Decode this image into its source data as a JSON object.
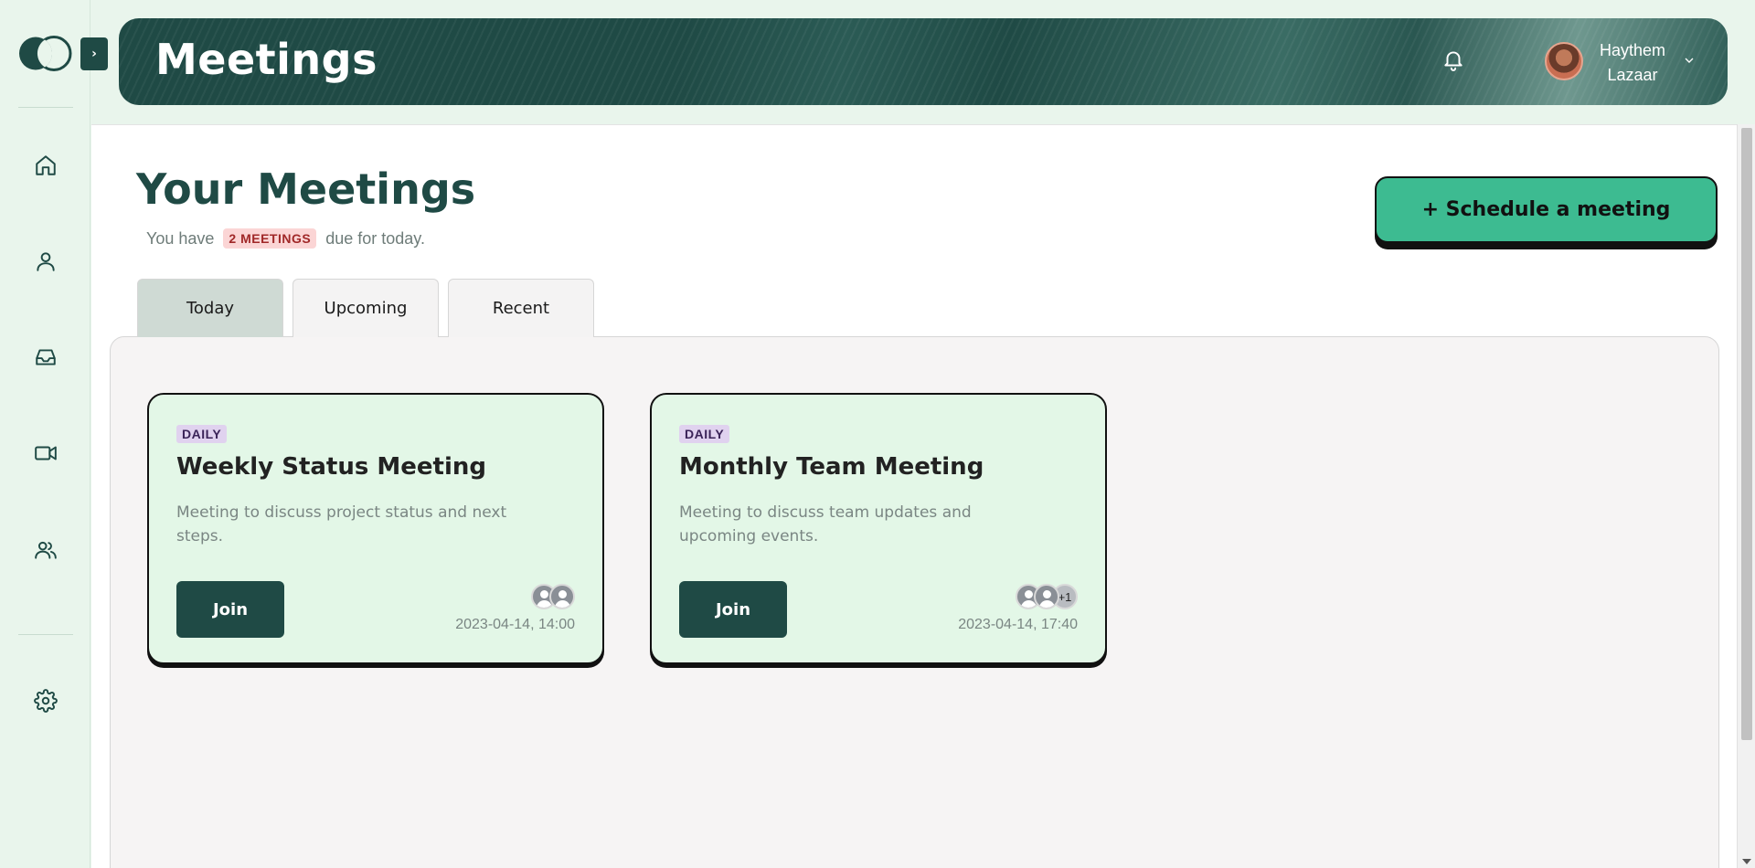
{
  "header": {
    "title": "Meetings",
    "user_first": "Haythem",
    "user_last": "Lazaar"
  },
  "sidebar": {
    "expand_label": "›",
    "items": [
      {
        "icon": "home-icon"
      },
      {
        "icon": "user-icon"
      },
      {
        "icon": "inbox-icon"
      },
      {
        "icon": "video-icon"
      },
      {
        "icon": "users-icon"
      },
      {
        "icon": "gear-icon"
      }
    ]
  },
  "main": {
    "title": "Your Meetings",
    "subtitle_pre": "You have",
    "count_badge": "2 MEETINGS",
    "subtitle_post": "due for today.",
    "schedule_button": "+ Schedule a meeting",
    "tabs": [
      {
        "label": "Today",
        "active": true
      },
      {
        "label": "Upcoming",
        "active": false
      },
      {
        "label": "Recent",
        "active": false
      }
    ]
  },
  "meetings": [
    {
      "badge": "DAILY",
      "title": "Weekly Status Meeting",
      "description": "Meeting to discuss project status and next steps.",
      "join_label": "Join",
      "datetime": "2023-04-14, 14:00",
      "participants": 2,
      "extra": ""
    },
    {
      "badge": "DAILY",
      "title": "Monthly Team Meeting",
      "description": "Meeting to discuss team updates and upcoming events.",
      "join_label": "Join",
      "datetime": "2023-04-14, 17:40",
      "participants": 2,
      "extra": "+1"
    }
  ],
  "colors": {
    "primary": "#1f4a45",
    "accent": "#3dbb91",
    "card_bg": "#e3f7e7",
    "badge_bg": "#e0d2ef",
    "count_bg": "#fbd5d5"
  }
}
